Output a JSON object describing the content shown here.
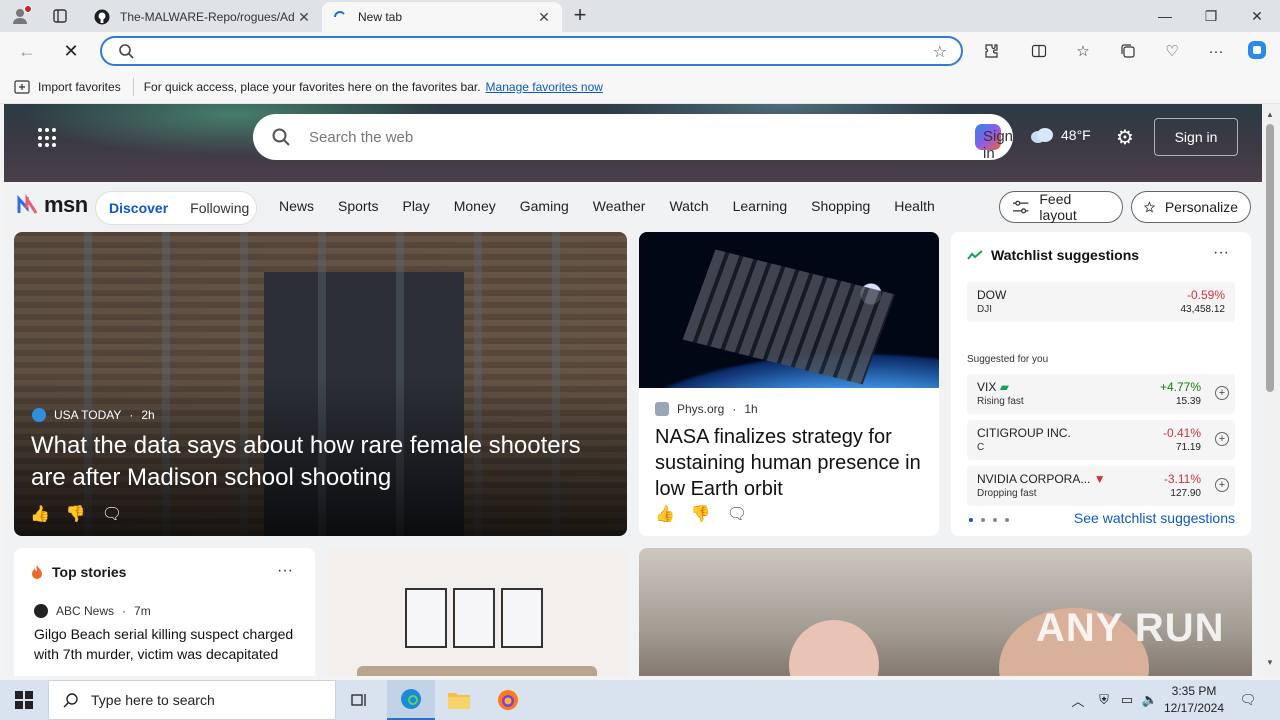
{
  "browser": {
    "tabs": [
      {
        "title": "The-MALWARE-Repo/rogues/Ad",
        "active": false
      },
      {
        "title": "New tab",
        "active": true
      }
    ],
    "address": {
      "value": "",
      "placeholder": ""
    },
    "favorites_bar": {
      "import_label": "Import favorites",
      "hint": "For quick access, place your favorites here on the favorites bar.",
      "manage_link": "Manage favorites now"
    }
  },
  "msn": {
    "search_placeholder": "Search the web",
    "signin_ghost": "Sign in",
    "weather": {
      "temp": "48°F",
      "icon": "cloud-icon"
    },
    "signin_button": "Sign in",
    "logo_text": "msn",
    "pill": {
      "discover": "Discover",
      "following": "Following"
    },
    "nav_links": [
      "News",
      "Sports",
      "Play",
      "Money",
      "Gaming",
      "Weather",
      "Watch",
      "Learning",
      "Shopping",
      "Health"
    ],
    "feed_layout": "Feed layout",
    "personalize": "Personalize",
    "big_story": {
      "source": "USA TODAY",
      "age": "2h",
      "headline": "What the data says about how rare female shooters are after Madison school shooting"
    },
    "nasa_story": {
      "source": "Phys.org",
      "age": "1h",
      "headline": "NASA finalizes strategy for sustaining human presence in low Earth orbit"
    },
    "watchlist": {
      "title": "Watchlist suggestions",
      "top": {
        "symbol": "DOW",
        "sub": "DJI",
        "change": "-0.59%",
        "price": "43,458.12"
      },
      "suggested_label": "Suggested for you",
      "items": [
        {
          "symbol": "VIX",
          "sub": "Rising fast",
          "change": "+4.77%",
          "price": "15.39",
          "trend": "up"
        },
        {
          "symbol": "CITIGROUP INC.",
          "sub": "C",
          "change": "-0.41%",
          "price": "71.19",
          "trend": "none"
        },
        {
          "symbol": "NVIDIA CORPORA...",
          "sub": "Dropping fast",
          "change": "-3.11%",
          "price": "127.90",
          "trend": "down"
        }
      ],
      "see_all": "See watchlist suggestions"
    },
    "top_stories": {
      "title": "Top stories",
      "source": "ABC News",
      "age": "7m",
      "headline": "Gilgo Beach serial killing suspect charged with 7th murder, victim was decapitated"
    },
    "watermark": "ANY RUN"
  },
  "taskbar": {
    "search_placeholder": "Type here to search",
    "time": "3:35 PM",
    "date": "12/17/2024"
  }
}
